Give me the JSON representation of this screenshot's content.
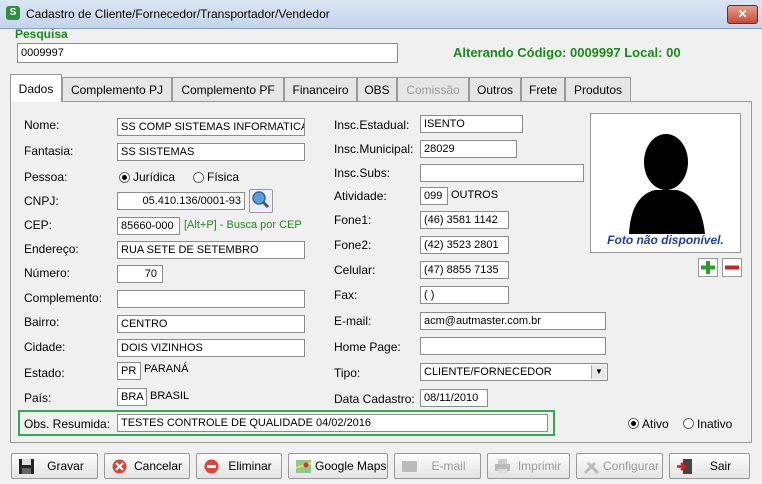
{
  "window": {
    "title": "Cadastro de Cliente/Fornecedor/Transportador/Vendedor",
    "close": "✕"
  },
  "search": {
    "label": "Pesquisa",
    "value": "0009997"
  },
  "status": {
    "text": "Alterando Código: 0009997  Local: 00"
  },
  "tabs": [
    {
      "label": "Dados",
      "active": true
    },
    {
      "label": "Complemento PJ"
    },
    {
      "label": "Complemento PF"
    },
    {
      "label": "Financeiro"
    },
    {
      "label": "OBS"
    },
    {
      "label": "Comissão",
      "disabled": true
    },
    {
      "label": "Outros"
    },
    {
      "label": "Frete"
    },
    {
      "label": "Produtos"
    }
  ],
  "form": {
    "nome": {
      "label": "Nome:",
      "value": "SS COMP SISTEMAS INFORMATICA"
    },
    "fantasia": {
      "label": "Fantasia:",
      "value": "SS SISTEMAS"
    },
    "pessoa": {
      "label": "Pessoa:",
      "opt1": "Jurídica",
      "opt2": "Física",
      "selected": "Jurídica"
    },
    "cnpj": {
      "label": "CNPJ:",
      "value": "05.410.136/0001-93"
    },
    "cep": {
      "label": "CEP:",
      "value": "85660-000",
      "hint": "[Alt+P]  - Busca por CEP"
    },
    "endereco": {
      "label": "Endereço:",
      "value": "RUA SETE DE SETEMBRO"
    },
    "numero": {
      "label": "Número:",
      "value": "70"
    },
    "complemento": {
      "label": "Complemento:",
      "value": ""
    },
    "bairro": {
      "label": "Bairro:",
      "value": "CENTRO"
    },
    "cidade": {
      "label": "Cidade:",
      "value": "DOIS VIZINHOS"
    },
    "estado": {
      "label": "Estado:",
      "code": "PR",
      "name": "PARANÁ"
    },
    "pais": {
      "label": "País:",
      "code": "BRA",
      "name": "BRASIL"
    },
    "obs": {
      "label": "Obs. Resumida:",
      "value": "TESTES CONTROLE DE QUALIDADE 04/02/2016"
    },
    "insc_estadual": {
      "label": "Insc.Estadual:",
      "value": "ISENTO"
    },
    "insc_municipal": {
      "label": "Insc.Municipal:",
      "value": "28029"
    },
    "insc_subs": {
      "label": "Insc.Subs:",
      "value": ""
    },
    "atividade": {
      "label": "Atividade:",
      "code": "099",
      "name": "OUTROS"
    },
    "fone1": {
      "label": "Fone1:",
      "value": "(46) 3581 1142"
    },
    "fone2": {
      "label": "Fone2:",
      "value": "(42) 3523 2801"
    },
    "celular": {
      "label": "Celular:",
      "value": "(47) 8855 7135"
    },
    "fax": {
      "label": "Fax:",
      "value": "(  )"
    },
    "email": {
      "label": "E-mail:",
      "value": "acm@autmaster.com.br"
    },
    "homepage": {
      "label": "Home Page:",
      "value": ""
    },
    "tipo": {
      "label": "Tipo:",
      "value": "CLIENTE/FORNECEDOR"
    },
    "data_cadastro": {
      "label": "Data Cadastro:",
      "value": "08/11/2010"
    },
    "ativo": {
      "opt1": "Ativo",
      "opt2": "Inativo",
      "selected": "Ativo"
    }
  },
  "photo": {
    "caption": "Foto não disponível."
  },
  "buttons": [
    {
      "label": "Gravar",
      "icon": "floppy-icon"
    },
    {
      "label": "Cancelar",
      "icon": "cancel-icon"
    },
    {
      "label": "Eliminar",
      "icon": "delete-icon"
    },
    {
      "label": "Google Maps",
      "icon": "map-icon"
    },
    {
      "label": "E-mail",
      "icon": "email-icon",
      "disabled": true
    },
    {
      "label": "Imprimir",
      "icon": "printer-icon",
      "disabled": true
    },
    {
      "label": "Configurar",
      "icon": "tools-icon",
      "disabled": true
    },
    {
      "label": "Sair",
      "icon": "exit-icon"
    }
  ],
  "colors": {
    "status": "#1a8a1a",
    "highlight_border": "#33aa55",
    "photo_caption": "#1f3fa8"
  }
}
